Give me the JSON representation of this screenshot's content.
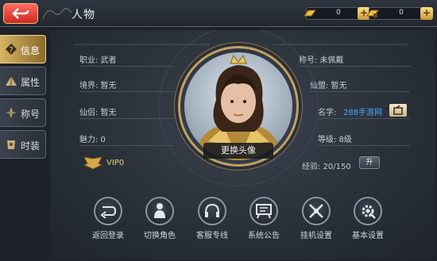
{
  "header": {
    "title": "人物",
    "resources": [
      {
        "icon": "gold-bar-icon",
        "value": "0"
      },
      {
        "icon": "locked-gold-icon",
        "value": "0"
      }
    ]
  },
  "sidebar": {
    "tabs": [
      {
        "label": "信息",
        "icon": "question-icon",
        "active": true
      },
      {
        "label": "属性",
        "icon": "pyramid-icon",
        "active": false
      },
      {
        "label": "称号",
        "icon": "compass-icon",
        "active": false
      },
      {
        "label": "时装",
        "icon": "armor-icon",
        "active": false
      }
    ]
  },
  "profile": {
    "left": [
      {
        "label": "职业: 武者"
      },
      {
        "label": "境界: 暂无"
      },
      {
        "label": "仙侣: 暂无"
      },
      {
        "label": "魅力: 0"
      }
    ],
    "right": [
      {
        "label": "称号: 未佩戴"
      },
      {
        "label": "仙盟: 暂无"
      },
      {
        "label": "名字:",
        "value": "288手游网"
      },
      {
        "label": "等级: 8级"
      },
      {
        "label": "经验: 20/150"
      }
    ],
    "vip": "VIP0",
    "change_avatar": "更换头像",
    "exp_up_label": "升"
  },
  "bottom_buttons": [
    {
      "label": "返回登录",
      "icon": "return-arrow-icon"
    },
    {
      "label": "切换角色",
      "icon": "character-icon"
    },
    {
      "label": "客服专线",
      "icon": "headset-icon"
    },
    {
      "label": "系统公告",
      "icon": "notice-board-icon"
    },
    {
      "label": "挂机设置",
      "icon": "crossed-swords-icon"
    },
    {
      "label": "基本设置",
      "icon": "settings-gear-icon"
    }
  ],
  "colors": {
    "accent_gold": "#d7b363",
    "back_button": "#e0463c",
    "name_value": "#4aa8ff"
  }
}
